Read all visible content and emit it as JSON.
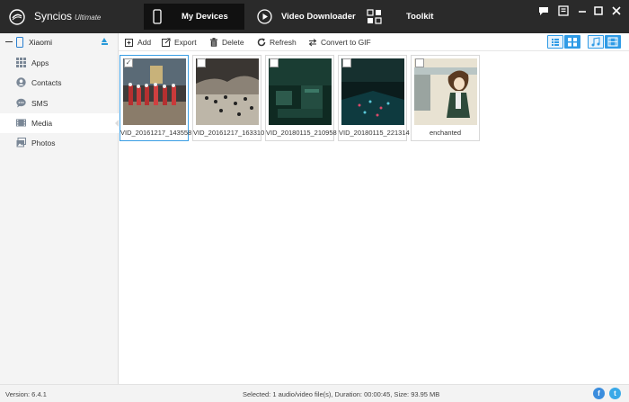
{
  "app": {
    "name": "Syncios",
    "edition": "Ultimate"
  },
  "nav_tabs": [
    {
      "label": "My Devices",
      "icon": "phone-icon",
      "active": true
    },
    {
      "label": "Video Downloader",
      "icon": "play-icon",
      "active": false
    },
    {
      "label": "Toolkit",
      "icon": "toolkit-icon",
      "active": false
    }
  ],
  "window_controls": [
    "chat-icon",
    "menu-icon",
    "minimize-icon",
    "maximize-icon",
    "close-icon"
  ],
  "device": {
    "name": "Xiaomi"
  },
  "sidebar": {
    "items": [
      {
        "label": "Apps",
        "icon": "apps-grid-icon",
        "active": false
      },
      {
        "label": "Contacts",
        "icon": "contacts-icon",
        "active": false
      },
      {
        "label": "SMS",
        "icon": "sms-icon",
        "active": false
      },
      {
        "label": "Media",
        "icon": "media-film-icon",
        "active": true
      },
      {
        "label": "Photos",
        "icon": "photos-icon",
        "active": false
      }
    ]
  },
  "toolbar": {
    "add_label": "Add",
    "export_label": "Export",
    "delete_label": "Delete",
    "refresh_label": "Refresh",
    "gif_label": "Convert to GIF"
  },
  "media_items": [
    {
      "label": "VID_20161217_143558",
      "checked": true,
      "selected": true,
      "scene": "parade"
    },
    {
      "label": "VID_20161217_163310",
      "checked": false,
      "selected": false,
      "scene": "cave"
    },
    {
      "label": "VID_20180115_210958",
      "checked": false,
      "selected": false,
      "scene": "dark-green"
    },
    {
      "label": "VID_20180115_221314",
      "checked": false,
      "selected": false,
      "scene": "dark-teal"
    },
    {
      "label": "enchanted",
      "checked": false,
      "selected": false,
      "scene": "anime"
    }
  ],
  "status": {
    "version": "Version: 6.4.1",
    "selection": "Selected: 1 audio/video file(s), Duration: 00:00:45, Size: 93.95 MB"
  },
  "colors": {
    "titlebar": "#2a2a2a",
    "accent": "#2f9be6",
    "facebook": "#3b8ddd",
    "twitter": "#39a9e8"
  }
}
